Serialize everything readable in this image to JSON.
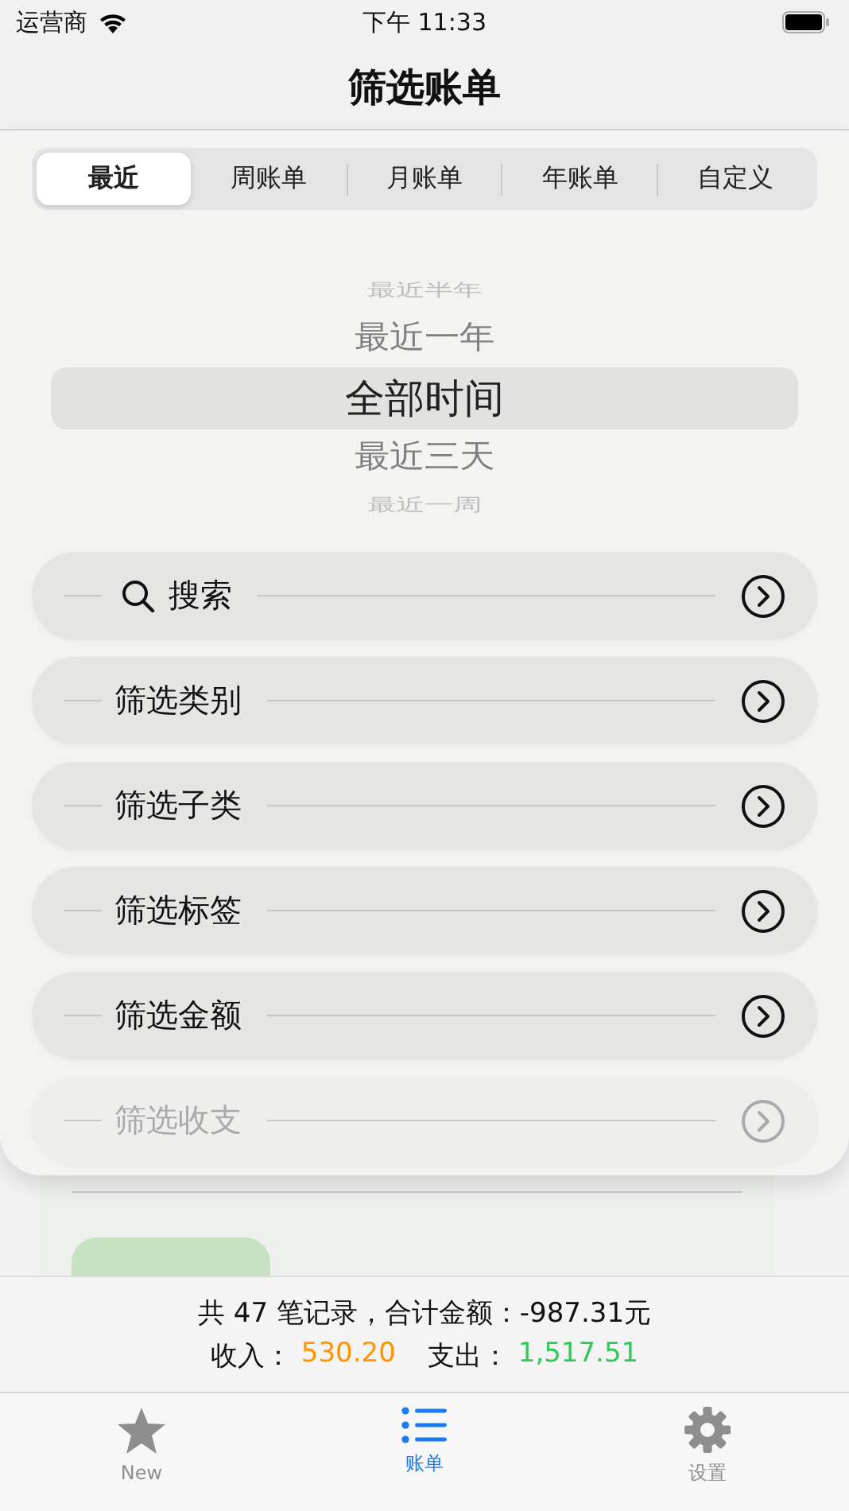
{
  "status_bar": {
    "carrier": "运营商",
    "time": "下午 11:33"
  },
  "nav": {
    "title": "筛选账单"
  },
  "segments": [
    {
      "label": "最近",
      "selected": true
    },
    {
      "label": "周账单",
      "selected": false
    },
    {
      "label": "月账单",
      "selected": false
    },
    {
      "label": "年账单",
      "selected": false
    },
    {
      "label": "自定义",
      "selected": false
    }
  ],
  "picker": [
    {
      "label": "最近半年",
      "selected": false
    },
    {
      "label": "最近一年",
      "selected": false
    },
    {
      "label": "全部时间",
      "selected": true
    },
    {
      "label": "最近三天",
      "selected": false
    },
    {
      "label": "最近一周",
      "selected": false
    }
  ],
  "filters": [
    {
      "kind": "search",
      "label": "搜索",
      "disabled": false
    },
    {
      "kind": "plain",
      "label": "筛选类别",
      "disabled": false
    },
    {
      "kind": "plain",
      "label": "筛选子类",
      "disabled": false
    },
    {
      "kind": "plain",
      "label": "筛选标签",
      "disabled": false
    },
    {
      "kind": "plain",
      "label": "筛选金额",
      "disabled": false
    },
    {
      "kind": "plain",
      "label": "筛选收支",
      "disabled": true
    }
  ],
  "summary": {
    "line": "共 47 笔记录，合计金额：-987.31元",
    "income_label": "收入：",
    "income": "530.20",
    "expense_label": "支出：",
    "expense": "1,517.51"
  },
  "tab_bar": [
    {
      "kind": "star",
      "label": "New",
      "selected": false
    },
    {
      "kind": "list",
      "label": "账单",
      "selected": true
    },
    {
      "kind": "gear",
      "label": "设置",
      "selected": false
    }
  ]
}
